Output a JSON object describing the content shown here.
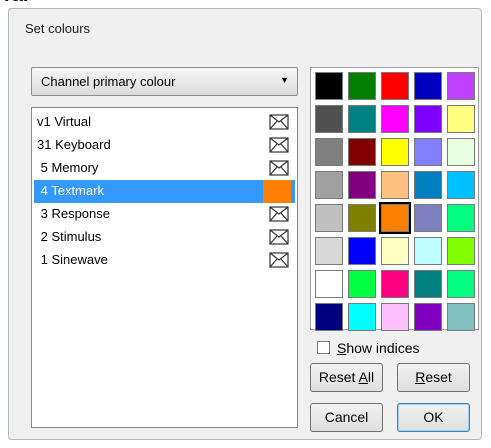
{
  "window": {
    "title": "Set colours"
  },
  "dropdown": {
    "value": "Channel primary colour"
  },
  "channels": [
    {
      "label": "v1 Virtual",
      "icon": "envelope-icon"
    },
    {
      "label": "31 Keyboard",
      "icon": "envelope-icon"
    },
    {
      "label": " 5 Memory",
      "icon": "envelope-icon"
    },
    {
      "label": " 4 Textmark",
      "icon": "colour-swatch",
      "color": "#ff8000",
      "selected": true
    },
    {
      "label": " 3 Response",
      "icon": "envelope-icon"
    },
    {
      "label": " 2 Stimulus",
      "icon": "envelope-icon"
    },
    {
      "label": " 1 Sinewave",
      "icon": "envelope-icon"
    }
  ],
  "palette": [
    [
      "#000000",
      "#008000",
      "#ff0000",
      "#0000c0",
      "#c040ff"
    ],
    [
      "#505050",
      "#008080",
      "#ff00ff",
      "#8000ff",
      "#ffff80"
    ],
    [
      "#808080",
      "#800000",
      "#ffff00",
      "#8080ff",
      "#e8ffe0"
    ],
    [
      "#a0a0a0",
      "#800080",
      "#ffc080",
      "#0080c0",
      "#00c0ff"
    ],
    [
      "#c0c0c0",
      "#808000",
      "#ff8000",
      "#8080c0",
      "#00ff80"
    ],
    [
      "#d8d8d8",
      "#0000ff",
      "#ffffc0",
      "#c0ffff",
      "#80ff00"
    ],
    [
      "#ffffff",
      "#00ff40",
      "#ff0080",
      "#008080",
      "#00ff80"
    ],
    [
      "#000080",
      "#00ffff",
      "#ffc0ff",
      "#8000c0",
      "#80c0c0"
    ]
  ],
  "selected_palette_color": "#ff8000",
  "show_indices": {
    "prefix": "",
    "accel": "S",
    "rest": "how indices",
    "checked": false
  },
  "buttons": {
    "reset_all": {
      "prefix": "Reset ",
      "accel": "A",
      "rest": "ll"
    },
    "reset": {
      "prefix": "",
      "accel": "R",
      "rest": "eset"
    },
    "cancel": "Cancel",
    "ok": "OK"
  }
}
